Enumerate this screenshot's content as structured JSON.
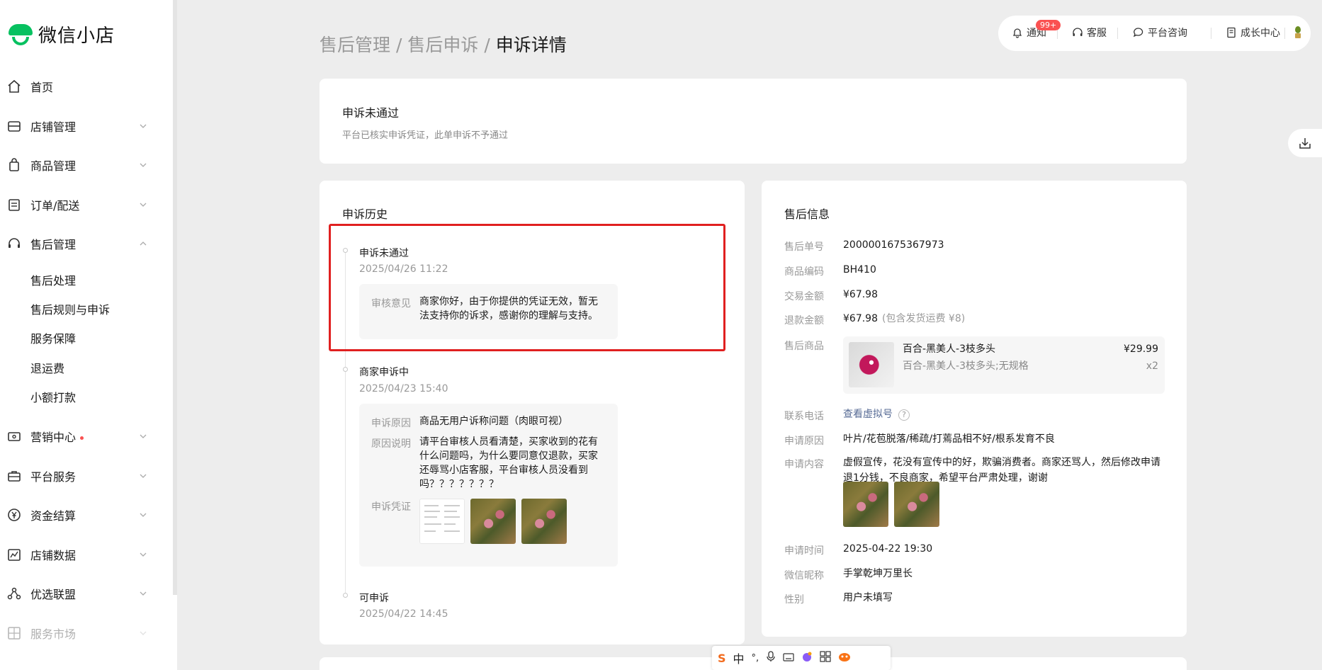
{
  "app": {
    "name": "微信小店"
  },
  "sidebar": {
    "items": [
      {
        "label": "首页",
        "icon": "home-icon"
      },
      {
        "label": "店铺管理",
        "icon": "store-icon"
      },
      {
        "label": "商品管理",
        "icon": "bag-icon"
      },
      {
        "label": "订单/配送",
        "icon": "order-icon"
      },
      {
        "label": "售后管理",
        "icon": "headset-icon",
        "expanded": true
      },
      {
        "label": "营销中心",
        "icon": "ticket-icon",
        "dot": true
      },
      {
        "label": "平台服务",
        "icon": "briefcase-icon"
      },
      {
        "label": "资金结算",
        "icon": "yen-icon"
      },
      {
        "label": "店铺数据",
        "icon": "chart-icon"
      },
      {
        "label": "优选联盟",
        "icon": "network-icon"
      },
      {
        "label": "服务市场",
        "icon": "grid-icon"
      }
    ],
    "aftersale_sub": [
      "售后处理",
      "售后规则与申诉",
      "服务保障",
      "退运费",
      "小额打款"
    ]
  },
  "breadcrumb": {
    "level1": "售后管理",
    "sep": "/",
    "level2": "售后申诉",
    "current": "申诉详情"
  },
  "toolbar": {
    "notify": "通知",
    "notify_badge": "99+",
    "service": "客服",
    "consult": "平台咨询",
    "growth": "成长中心"
  },
  "status": {
    "title": "申诉未通过",
    "desc": "平台已核实申诉凭证，此单申诉不予通过"
  },
  "history": {
    "title": "申诉历史",
    "events": [
      {
        "title": "申诉未通过",
        "time": "2025/04/26 11:22",
        "review_key": "审核意见",
        "review_line1": "商家你好，由于你提供的凭证无效，暂无",
        "review_line2": "法支持你的诉求，感谢你的理解与支持。"
      },
      {
        "title": "商家申诉中",
        "time": "2025/04/23 15:40",
        "reason_key": "申诉原因",
        "reason": "商品无用户诉称问题（肉眼可视）",
        "explain_key": "原因说明",
        "explain_line1": "请平台审核人员看清楚，买家收到的花有",
        "explain_line2": "什么问题吗，为什么要同意仅退款，买家",
        "explain_line3": "还辱骂小店客服，平台审核人员没看到",
        "explain_line4": "吗？？？？？？？",
        "evidence_key": "申诉凭证"
      },
      {
        "title": "可申诉",
        "time": "2025/04/22 14:45"
      }
    ]
  },
  "aftersale": {
    "title": "售后信息",
    "order_no_key": "售后单号",
    "order_no": "2000001675367973",
    "sku_key": "商品编码",
    "sku": "BH410",
    "amount_key": "交易金额",
    "amount": "¥67.98",
    "refund_key": "退款金额",
    "refund": "¥67.98",
    "refund_note": "(包含发货运费 ¥8)",
    "goods_key": "售后商品",
    "goods_name": "百合-黑美人-3枝多头",
    "goods_spec": "百合-黑美人-3枝多头;无规格",
    "goods_price": "¥29.99",
    "goods_qty": "x2",
    "phone_key": "联系电话",
    "phone_link": "查看虚拟号",
    "reason_key": "申请原因",
    "reason": "叶片/花苞脱落/稀疏/打蔫品相不好/根系发育不良",
    "content_key": "申请内容",
    "content_line1": "虚假宣传，花没有宣传中的好，欺骗消费者。商家还骂人，然后修改申请",
    "content_line2": "退1分钱，不良商家，希望平台严肃处理，谢谢",
    "time_key": "申请时间",
    "time": "2025-04-22 19:30",
    "nick_key": "微信昵称",
    "nick": "手掌乾坤万里长",
    "gender_key": "性别",
    "gender": "用户未填写"
  },
  "ime": {
    "mode": "中",
    "punct": "°,"
  }
}
